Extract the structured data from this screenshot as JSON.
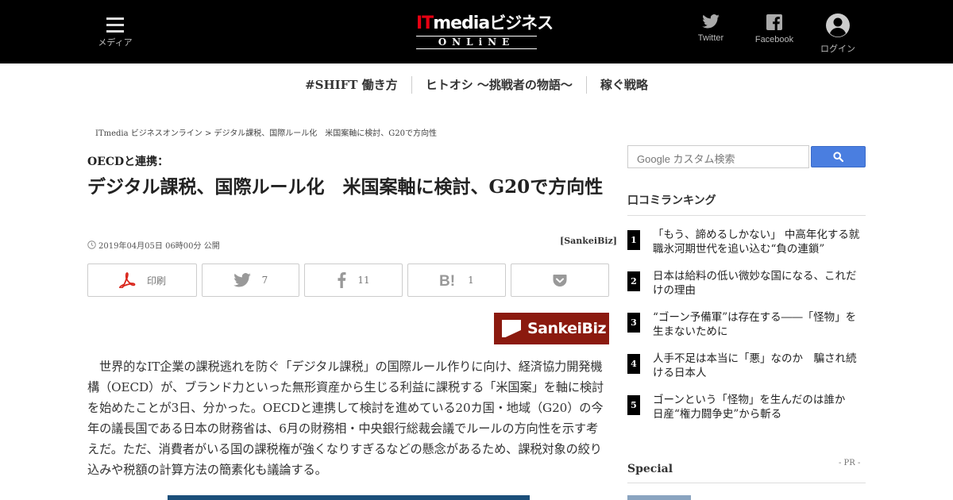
{
  "header": {
    "menu_label": "メディア",
    "logo": {
      "brand": "ITmedia",
      "it": "IT",
      "media": "media",
      "biz": "ビジネス",
      "online": "ONLiNE"
    },
    "twitter_label": "Twitter",
    "facebook_label": "Facebook",
    "login_label": "ログイン"
  },
  "subnav": {
    "items": [
      "#SHIFT 働き方",
      "ヒトオシ ～挑戦者の物語～",
      "稼ぐ戦略"
    ]
  },
  "breadcrumb": "ITmedia ビジネスオンライン > デジタル課税、国際ルール化　米国案軸に検討、G20で方向性",
  "article": {
    "kicker": "OECDと連携：",
    "title": "デジタル課税、国際ルール化　米国案軸に検討、G20で方向性",
    "date": "2019年04月05日 06時00分 公開",
    "source": "[SankeiBiz]",
    "share": {
      "print_label": "印刷",
      "twitter_count": "7",
      "facebook_count": "11",
      "hatena_count": "1"
    },
    "partner_logo": "SankeiBiz",
    "body": "世界的なIT企業の課税逃れを防ぐ「デジタル課税」の国際ルール作りに向け、経済協力開発機構（OECD）が、ブランド力といった無形資産から生じる利益に課税する「米国案」を軸に検討を始めたことが3日、分かった。OECDと連携して検討を進めている20カ国・地域（G20）の今年の議長国である日本の財務省は、6月の財務相・中央銀行総裁会議でルールの方向性を示す考えだ。ただ、消費者がいる国の課税権が強くなりすぎるなどの懸念があるため、課税対象の絞り込みや税額の計算方法の簡素化も議論する。"
  },
  "sidebar": {
    "search_placeholder": "Google カスタム検索",
    "ranking_title": "口コミランキング",
    "ranking": [
      {
        "rank": "1",
        "text": "「もう、諦めるしかない」 中高年化する就職氷河期世代を追い込む“負の連鎖”"
      },
      {
        "rank": "2",
        "text": "日本は給料の低い微妙な国になる、これだけの理由"
      },
      {
        "rank": "3",
        "text": "“ゴーン予備軍”は存在する――「怪物」を生まないために"
      },
      {
        "rank": "4",
        "text": "人手不足は本当に「悪」なのか　騙され続ける日本人"
      },
      {
        "rank": "5",
        "text": "ゴーンという「怪物」を生んだのは誰か　日産“権力闘争史”から斬る"
      }
    ],
    "special_title": "Special",
    "pr_label": "- PR -"
  },
  "colors": {
    "header_bg": "#000000",
    "logo_red": "#e60012",
    "sankeibiz_bg": "#8b1a0f",
    "search_button": "#4a7ee0",
    "pdf_red": "#d9261c"
  }
}
